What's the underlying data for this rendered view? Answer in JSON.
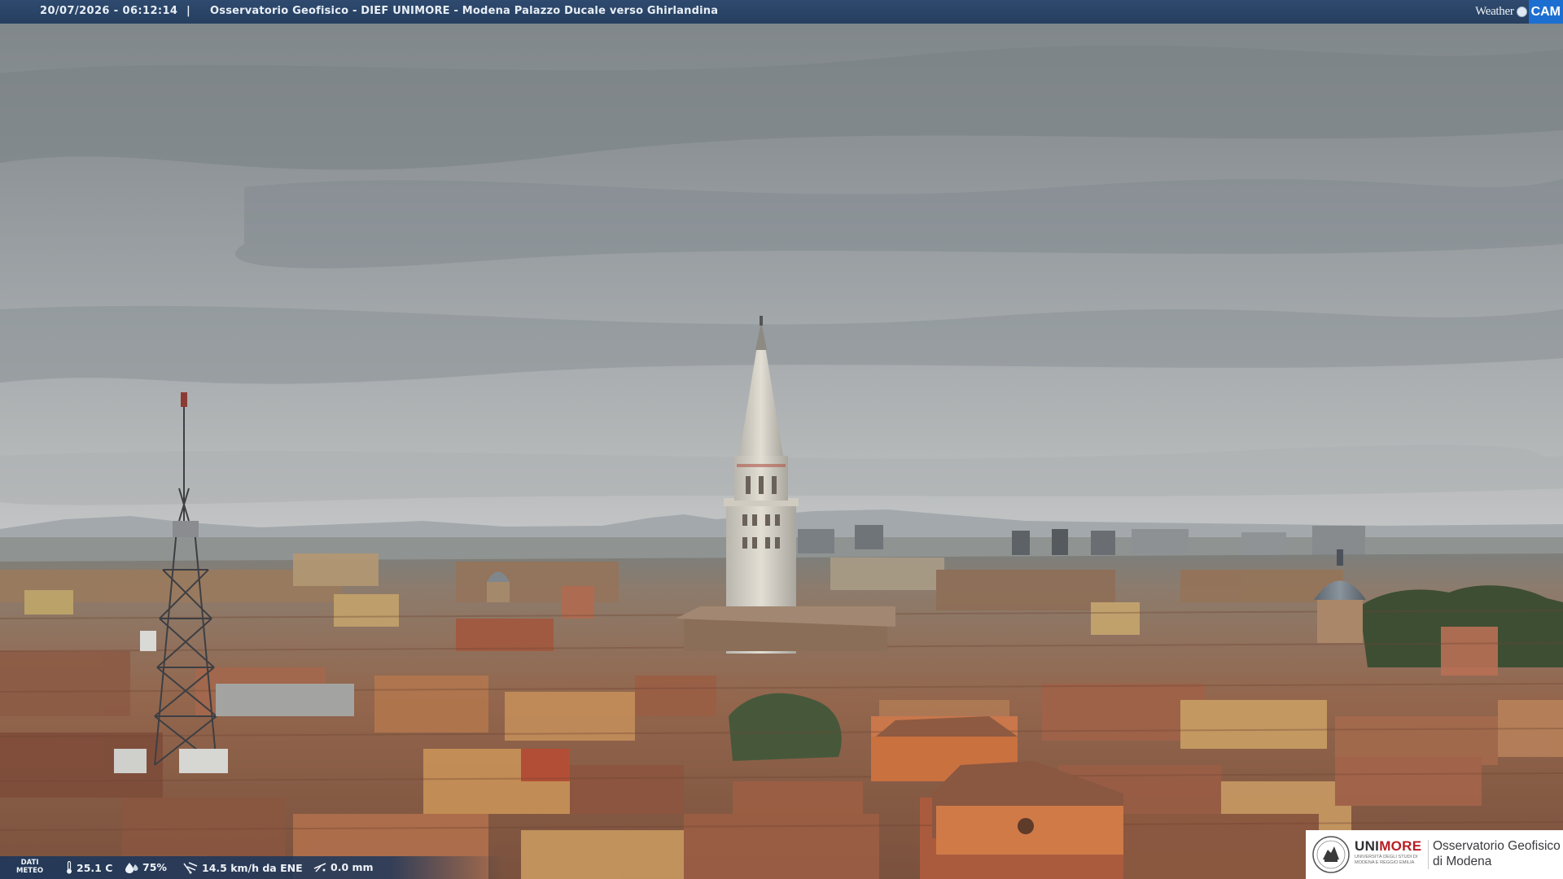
{
  "header": {
    "timestamp": "20/07/2026 - 06:12:14",
    "separator": "|",
    "title": "Osservatorio Geofisico - DIEF UNIMORE - Modena Palazzo Ducale verso Ghirlandina",
    "brand_weather": "Weather",
    "brand_cam": "CAM"
  },
  "meteo": {
    "label_line1": "DATI",
    "label_line2": "METEO",
    "temperature": "25.1 C",
    "humidity": "75%",
    "wind": "14.5 km/h da ENE",
    "rain": "0.0 mm",
    "icons": [
      "thermometer-icon",
      "humidity-drop-icon",
      "wind-icon",
      "rain-icon"
    ]
  },
  "logo": {
    "uni": "UNI",
    "more": "MORE",
    "subtitle": "UNIVERSITÀ DEGLI STUDI DI MODENA E REGGIO EMILIA",
    "observatory_line1": "Osservatorio Geofisico",
    "observatory_line2": "di Modena"
  },
  "colors": {
    "sky": "#8d9397",
    "roof": "#9a6a4e",
    "bar": "#2e4a6e",
    "accent_cam": "#1c6fd1",
    "unimore_red": "#b81e23"
  }
}
